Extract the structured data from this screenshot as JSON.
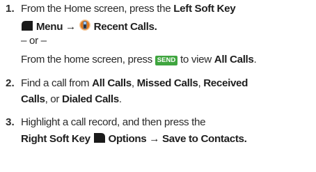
{
  "steps": [
    {
      "number": "1.",
      "line1_prefix": "From the Home screen, press the ",
      "line1_bold": "Left Soft Key",
      "menu_label": "Menu",
      "arrow": "→",
      "recent_calls": "Recent Calls",
      "recent_calls_period": ".",
      "or_text": "– or –",
      "alt_prefix": "From the home screen, press ",
      "send_key": "SEND",
      "alt_middle": " to view ",
      "all_calls": "All Calls",
      "alt_period": "."
    },
    {
      "number": "2.",
      "prefix": "Find a call from ",
      "all_calls": "All Calls",
      "sep1": ", ",
      "missed_calls": "Missed Calls",
      "sep2": ", ",
      "received": "Received",
      "calls": "Calls",
      "sep3": ", or ",
      "dialed_calls": "Dialed Calls",
      "period": "."
    },
    {
      "number": "3.",
      "line1": "Highlight a call record, and then press the",
      "right_soft_key": "Right Soft Key",
      "options": "Options",
      "arrow": "→",
      "save_to_contacts": "Save to Contacts",
      "period": "."
    }
  ],
  "colors": {
    "text": "#2b2b2b",
    "send_badge": "#3fa53f",
    "soft_key_icon": "#1a1a1a",
    "recent_calls_icon": "#e07a1f"
  },
  "icons": {
    "left_soft_key": "left-soft-key-icon",
    "recent_calls": "recent-calls-icon",
    "right_soft_key": "right-soft-key-icon"
  }
}
